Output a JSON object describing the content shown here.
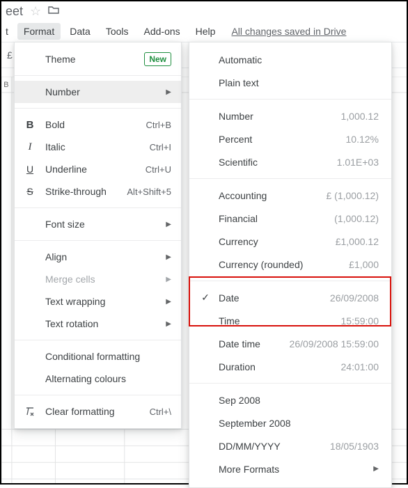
{
  "titlebar": {
    "doc_name_suffix": "eet"
  },
  "menubar": {
    "insert_suffix": "t",
    "format": "Format",
    "data": "Data",
    "tools": "Tools",
    "addons": "Add-ons",
    "help": "Help",
    "save_status": "All changes saved in Drive"
  },
  "toolbar": {
    "currency_symbol": "£"
  },
  "grid": {
    "col_label": "B"
  },
  "format_menu": {
    "theme": "Theme",
    "theme_badge": "New",
    "number": "Number",
    "bold": "Bold",
    "bold_kb": "Ctrl+B",
    "italic": "Italic",
    "italic_kb": "Ctrl+I",
    "underline": "Underline",
    "underline_kb": "Ctrl+U",
    "strike": "Strike-through",
    "strike_kb": "Alt+Shift+5",
    "font_size": "Font size",
    "align": "Align",
    "merge": "Merge cells",
    "wrap": "Text wrapping",
    "rotate": "Text rotation",
    "cond": "Conditional formatting",
    "alt": "Alternating colours",
    "clear": "Clear formatting",
    "clear_kb": "Ctrl+\\"
  },
  "number_menu": {
    "automatic": "Automatic",
    "plain": "Plain text",
    "number": "Number",
    "number_v": "1,000.12",
    "percent": "Percent",
    "percent_v": "10.12%",
    "scientific": "Scientific",
    "scientific_v": "1.01E+03",
    "accounting": "Accounting",
    "accounting_v": "£ (1,000.12)",
    "financial": "Financial",
    "financial_v": "(1,000.12)",
    "currency": "Currency",
    "currency_v": "£1,000.12",
    "currency_r": "Currency (rounded)",
    "currency_r_v": "£1,000",
    "date": "Date",
    "date_v": "26/09/2008",
    "time": "Time",
    "time_v": "15:59:00",
    "datetime": "Date time",
    "datetime_v": "26/09/2008 15:59:00",
    "duration": "Duration",
    "duration_v": "24:01:00",
    "mon_short": "Sep 2008",
    "mon_long": "September 2008",
    "dmy": "DD/MM/YYYY",
    "dmy_v": "18/05/1903",
    "more": "More Formats"
  },
  "glyphs": {
    "arrow_right": "▶",
    "check": "✓",
    "star": "☆",
    "folder": "■"
  }
}
